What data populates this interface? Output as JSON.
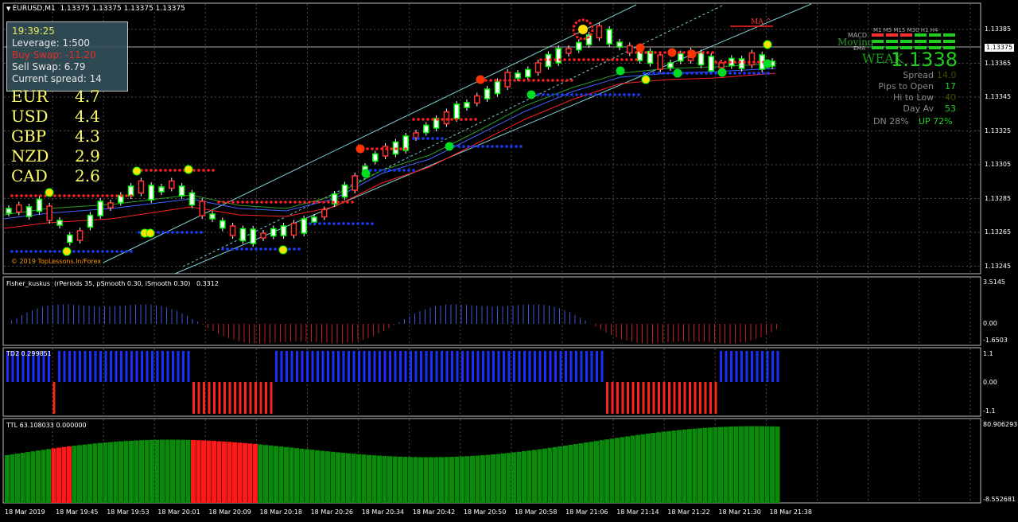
{
  "window": {
    "title": "EURUSD,M1  1.13375 1.13375 1.13375 1.13375",
    "price_tag": "1.13375",
    "copyright": "© 2019 TopLessons.In/Forex"
  },
  "info_box": {
    "time": "19:39:25",
    "leverage": "Leverage:  1:500",
    "buy_swap": "Buy Swap: -11.20",
    "sell_swap": "Sell Swap: 6.79",
    "spread": "Current spread: 14"
  },
  "currency_strength": [
    {
      "currency": "EUR",
      "value": "4.7"
    },
    {
      "currency": "USD",
      "value": "4.4"
    },
    {
      "currency": "GBP",
      "value": "4.3"
    },
    {
      "currency": "NZD",
      "value": "2.9"
    },
    {
      "currency": "CAD",
      "value": "2.6"
    }
  ],
  "dashboard": {
    "timeframes": "M1 M5 M15 M30 H1 H4",
    "row_labels": [
      "MACD",
      "Moving",
      "EMA"
    ],
    "weak_label": "WEAK",
    "big_price": "1.1338",
    "ma_label": "MA ^",
    "stats": [
      {
        "label": "Spread",
        "value": "14.0"
      },
      {
        "label": "Pips to Open",
        "value": "17"
      },
      {
        "label": "Hi to Low",
        "value": "40"
      },
      {
        "label": "Day Av",
        "value": "53"
      }
    ],
    "dn": "DN 28%",
    "up": "UP 72%"
  },
  "price_axis": [
    "1.13385",
    "1.13365",
    "1.13345",
    "1.13325",
    "1.13305",
    "1.13285",
    "1.13265",
    "1.13245"
  ],
  "fisher": {
    "label": "Fisher_kuskus  (rPeriods 35, pSmooth 0.30, iSmooth 0.30)   0.3312",
    "axis": [
      "3.5145",
      "0.00",
      "-1.6503"
    ]
  },
  "td2": {
    "label": "TD2 0.299851",
    "axis": [
      "1.1",
      "0.00",
      "-1.1"
    ]
  },
  "ttl": {
    "label": "TTL 63.108033 0.000000",
    "axis": [
      "80.906293",
      "-8.552681"
    ]
  },
  "time_axis": [
    "18 Mar 2019",
    "18 Mar 19:45",
    "18 Mar 19:53",
    "18 Mar 20:01",
    "18 Mar 20:09",
    "18 Mar 20:18",
    "18 Mar 20:26",
    "18 Mar 20:34",
    "18 Mar 20:42",
    "18 Mar 20:50",
    "18 Mar 20:58",
    "18 Mar 21:06",
    "18 Mar 21:14",
    "18 Mar 21:22",
    "18 Mar 21:30",
    "18 Mar 21:38"
  ],
  "colors": {
    "bull": "#00ff00",
    "bear": "#ff3030",
    "grid": "#4a4a4a",
    "blue": "#1a3cff",
    "green_hist": "#0a8a0a",
    "red_hist": "#ff1a1a"
  }
}
